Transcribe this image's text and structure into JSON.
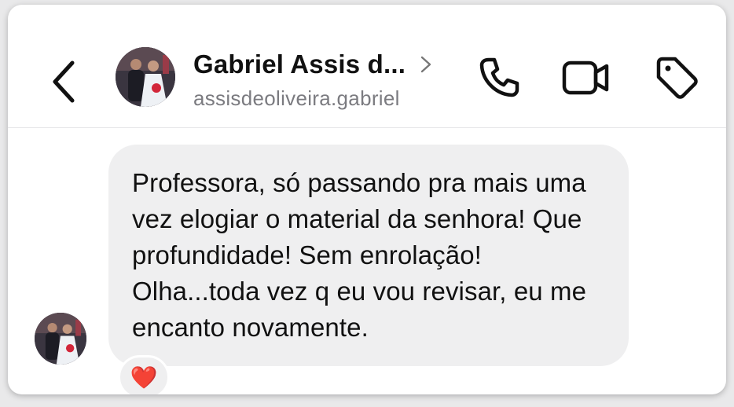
{
  "header": {
    "contact_name": "Gabriel Assis d...",
    "username": "assisdeoliveira.gabriel",
    "icons": {
      "back": "chevron-left-icon",
      "profile_chevron": "chevron-right-icon",
      "call": "phone-icon",
      "video_call": "video-camera-icon",
      "label": "tag-icon"
    }
  },
  "messages": [
    {
      "text": "Professora, só passando pra mais uma vez elogiar o material da senhora! Que profundidade! Sem enrolação! Olha...toda vez q eu vou revisar, eu me encanto novamente.",
      "reaction": "❤️"
    }
  ],
  "colors": {
    "bubble_bg": "#efeff0",
    "username": "#7b7b80",
    "reaction_heart": "#e0243b"
  }
}
